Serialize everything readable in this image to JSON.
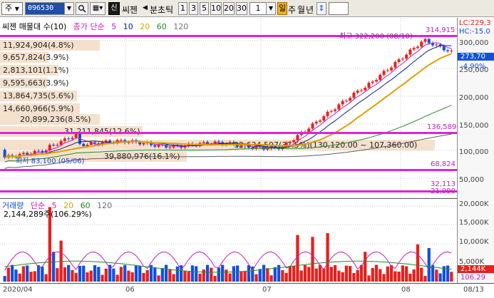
{
  "toolbar": {
    "market": "주",
    "code": "096530",
    "stock_badge": "신",
    "stock_name": "씨젠",
    "chart_type": "분초틱",
    "interval_buttons": [
      "1",
      "3",
      "5",
      "10",
      "20",
      "30"
    ],
    "interval_value": "1",
    "period_buttons": [
      "일",
      "주",
      "월",
      "년"
    ]
  },
  "price_pane": {
    "legend": {
      "title": "씨젠 매물대 수(10)",
      "ma_label": "종가 단순",
      "ma_periods": [
        "5",
        "10",
        "20",
        "60",
        "120"
      ]
    },
    "volume_profile": [
      "11,924,904(4.8%)",
      "9,657,824(3.9%)",
      "2,813,101(1.1%)",
      "9,595,663(3.9%)",
      "13,864,735(5.6%)",
      "14,660,966(5.9%)",
      "20,899,236(8.5%)",
      "31,211,845(12.6%)",
      "92,634,597(37.5%)(130,120.00 ~ 107,360.00)",
      "39,880,976(16.1%)"
    ],
    "high_label": "최고 322,200 (08/10)",
    "low_label": "최저 83,100 (05/06)",
    "right_labels": {
      "lc": "LC:229,3",
      "hc": "HC:-15.0",
      "last_high": "314,915",
      "current": "273,70",
      "change": "-4.90%",
      "ma_level1": "136,589",
      "ma_level2": "68,824",
      "ma_level3": "32,113",
      "ma_level4": "21,990"
    },
    "axis_ticks": [
      "300,000",
      "250,000",
      "200,000",
      "150,000",
      "100,000",
      "50,000"
    ]
  },
  "volume_pane": {
    "legend": {
      "title": "거래량",
      "ma_label": "단순",
      "ma_periods": [
        "5",
        "20",
        "60",
        "120"
      ]
    },
    "value_label": "2,144,289주(106.29%)",
    "axis_ticks": [
      "20,000K",
      "15,000K",
      "10,000K",
      "5,000K"
    ],
    "current_tag": "2,144K",
    "bottom_tag": "106.29"
  },
  "x_axis": {
    "labels": [
      "2020/04",
      "06",
      "07",
      "08",
      "08/13"
    ]
  },
  "colors": {
    "up": "#e8201c",
    "down": "#1050e0",
    "ma5": "#c41ec4",
    "ma10": "#0a2a80",
    "ma20": "#e0a000",
    "ma60": "#2a8a2a",
    "ma120": "#606060",
    "highlight": "#e020e0",
    "profile": "#f2dcc4"
  },
  "icons": [
    "search-icon",
    "chevron-down-icon",
    "left-arrow-icon",
    "up-down-arrow-icon"
  ]
}
